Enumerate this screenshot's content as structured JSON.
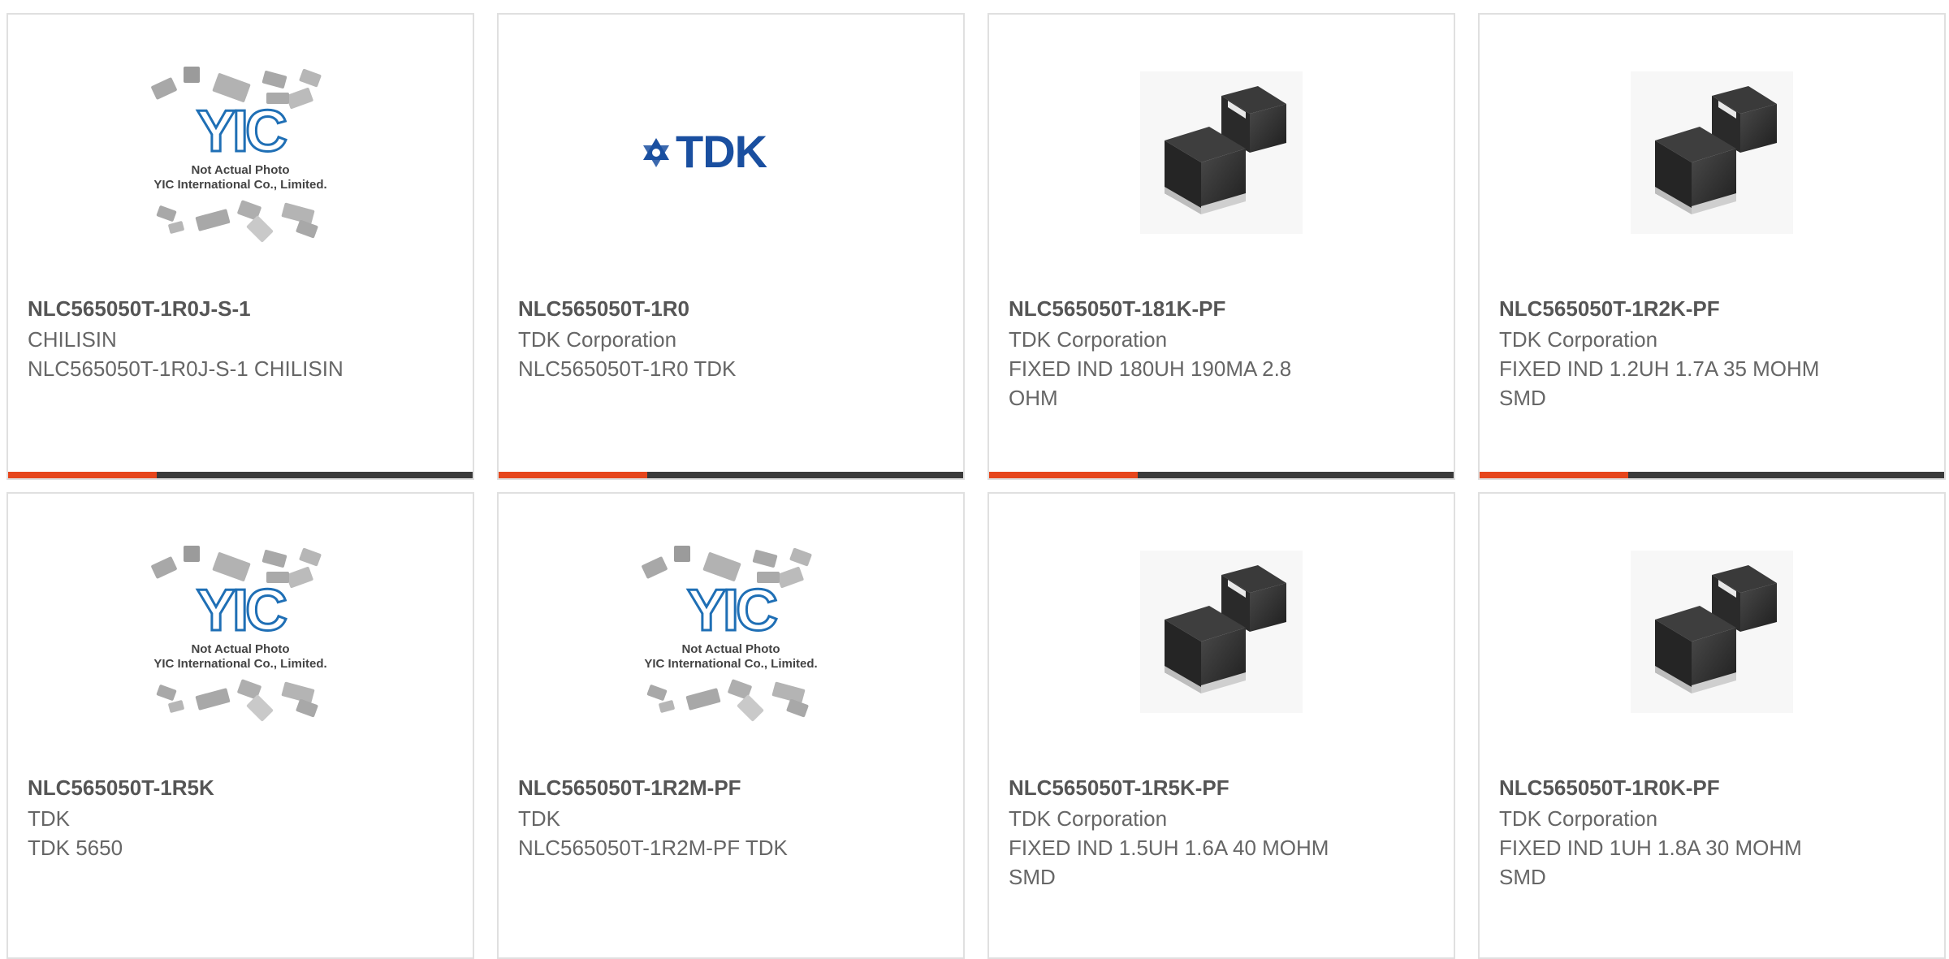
{
  "products": [
    {
      "part_number": "NLC565050T-1R0J-S-1",
      "manufacturer": "CHILISIN",
      "description": "NLC565050T-1R0J-S-1 CHILISIN",
      "image": "placeholder",
      "placeholder": {
        "logo": "YIC",
        "line1": "Not Actual Photo",
        "line2": "YIC International Co., Limited."
      }
    },
    {
      "part_number": "NLC565050T-1R0",
      "manufacturer": "TDK Corporation",
      "description": "NLC565050T-1R0 TDK",
      "image": "tdk-logo",
      "brand": "TDK"
    },
    {
      "part_number": "NLC565050T-181K-PF",
      "manufacturer": "TDK Corporation",
      "description": "FIXED IND 180UH 190MA 2.8 OHM",
      "image": "inductor"
    },
    {
      "part_number": "NLC565050T-1R2K-PF",
      "manufacturer": "TDK Corporation",
      "description": "FIXED IND 1.2UH 1.7A 35 MOHM SMD",
      "image": "inductor"
    },
    {
      "part_number": "NLC565050T-1R5K",
      "manufacturer": "TDK",
      "description": "TDK 5650",
      "image": "placeholder",
      "placeholder": {
        "logo": "YIC",
        "line1": "Not Actual Photo",
        "line2": "YIC International Co., Limited."
      }
    },
    {
      "part_number": "NLC565050T-1R2M-PF",
      "manufacturer": "TDK",
      "description": "NLC565050T-1R2M-PF TDK",
      "image": "placeholder",
      "placeholder": {
        "logo": "YIC",
        "line1": "Not Actual Photo",
        "line2": "YIC International Co., Limited."
      }
    },
    {
      "part_number": "NLC565050T-1R5K-PF",
      "manufacturer": "TDK Corporation",
      "description": "FIXED IND 1.5UH 1.6A 40 MOHM SMD",
      "image": "inductor"
    },
    {
      "part_number": "NLC565050T-1R0K-PF",
      "manufacturer": "TDK Corporation",
      "description": "FIXED IND 1UH 1.8A 30 MOHM SMD",
      "image": "inductor"
    }
  ],
  "colors": {
    "accent": "#e6461c",
    "bar": "#3a3a3a",
    "border": "#e0e0e0",
    "tdk_blue": "#1a4fa0",
    "yic_blue": "#1f6fb5"
  }
}
